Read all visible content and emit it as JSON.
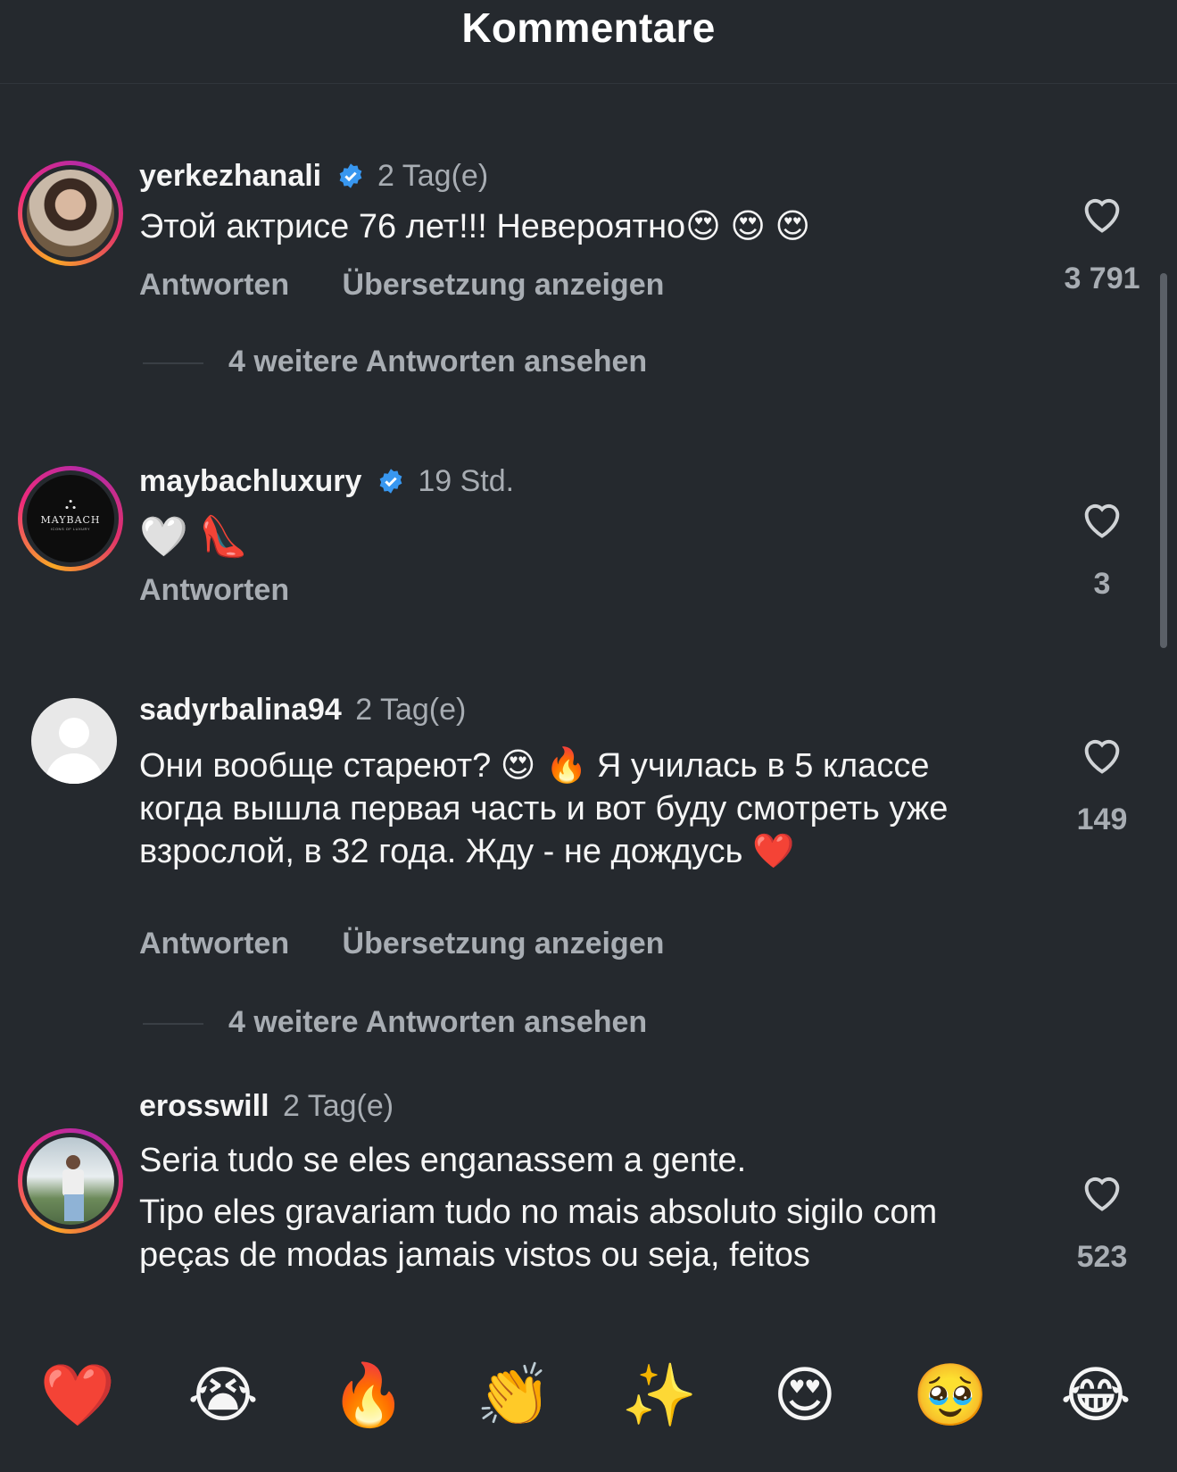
{
  "header": {
    "title": "Kommentare"
  },
  "comments": [
    {
      "username": "yerkezhanali",
      "time": "2 Tag(e)",
      "text": "Этой актрисе 76 лет!!! Невероятно😍 😍 😍",
      "reply_label": "Antworten",
      "translate_label": "Übersetzung anzeigen",
      "likes": "3 791",
      "more_replies": "4 weitere Antworten ansehen"
    },
    {
      "username": "maybachluxury",
      "time": "19 Std.",
      "text": "🤍 👠",
      "reply_label": "Antworten",
      "likes": "3",
      "avatar_label": "MAYBACH",
      "avatar_sublabel": "ICONS OF LUXURY"
    },
    {
      "username": "sadyrbalina94",
      "time": "2 Tag(e)",
      "text": "Они вообще стареют? 😍 🔥 Я училась в 5 классе когда вышла первая часть и вот буду смотреть уже взрослой, в 32 года. Жду - не дождусь ❤️",
      "reply_label": "Antworten",
      "translate_label": "Übersetzung anzeigen",
      "likes": "149",
      "more_replies": "4 weitere Antworten ansehen"
    },
    {
      "username": "erosswill",
      "time": "2 Tag(e)",
      "text": "Seria tudo se eles enganassem a gente.",
      "text2": "Tipo eles gravariam tudo no mais absoluto sigilo com peças de modas jamais vistos ou seja, feitos",
      "likes": "523"
    }
  ],
  "reactions": [
    "❤️",
    "😭",
    "🔥",
    "👏",
    "✨",
    "😍",
    "🥹",
    "😂"
  ],
  "colors": {
    "background": "#25292e",
    "verified": "#3897f0",
    "muted": "#a8adb3"
  }
}
